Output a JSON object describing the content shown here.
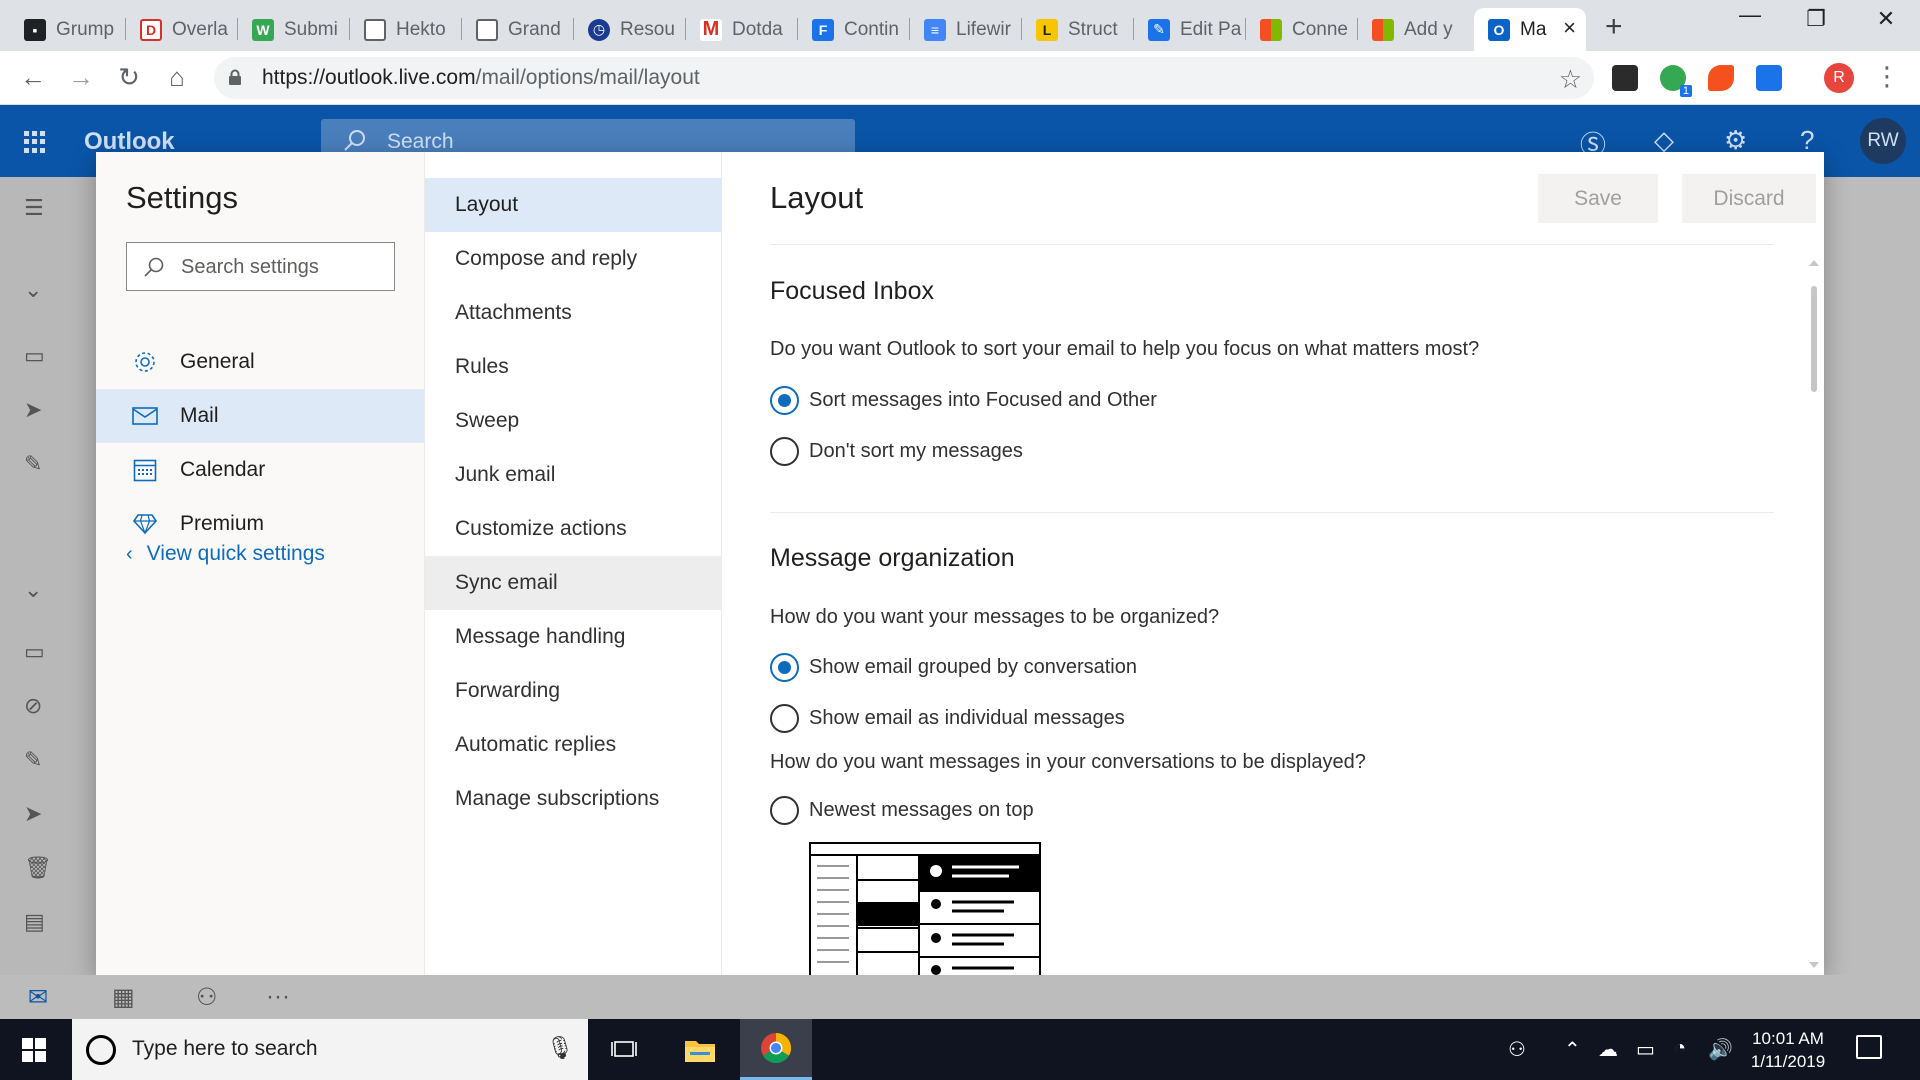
{
  "browser": {
    "tabs": [
      {
        "title": "Grump",
        "icon": "grammarly-icon",
        "color": "#202124"
      },
      {
        "title": "Overla",
        "icon": "document-icon",
        "color": "#d93025"
      },
      {
        "title": "Submi",
        "icon": "leaf-icon",
        "color": "#34a853"
      },
      {
        "title": "Hekto",
        "icon": "file-icon",
        "color": "#5f6368"
      },
      {
        "title": "Grand",
        "icon": "file-icon",
        "color": "#5f6368"
      },
      {
        "title": "Resou",
        "icon": "clock-icon",
        "color": "#1a3b8f"
      },
      {
        "title": "Dotda",
        "icon": "gmail-icon",
        "color": "#d93025"
      },
      {
        "title": "Contin",
        "icon": "flow-icon",
        "color": "#1a73e8"
      },
      {
        "title": "Lifewir",
        "icon": "docs-icon",
        "color": "#4285f4"
      },
      {
        "title": "Struct",
        "icon": "l-icon",
        "color": "#f9c400"
      },
      {
        "title": "Edit Pa",
        "icon": "edit-icon",
        "color": "#1a73e8"
      },
      {
        "title": "Conne",
        "icon": "microsoft-icon",
        "color": "#f25022"
      },
      {
        "title": "Add y",
        "icon": "microsoft-icon",
        "color": "#f25022"
      },
      {
        "title": "Ma",
        "icon": "outlook-icon",
        "color": "#0a64c8"
      }
    ],
    "url_host": "https://outlook.live.com",
    "url_path": "/mail/options/mail/layout",
    "profile_initial": "R",
    "extension_badge": "1"
  },
  "outlook": {
    "brand": "Outlook",
    "search_placeholder": "Search",
    "avatar_initials": "RW",
    "accent": "#0a55a8"
  },
  "settings": {
    "title": "Settings",
    "search_placeholder": "Search settings",
    "categories": [
      {
        "label": "General",
        "icon": "gear-icon"
      },
      {
        "label": "Mail",
        "icon": "mail-icon",
        "selected": true
      },
      {
        "label": "Calendar",
        "icon": "calendar-icon"
      },
      {
        "label": "Premium",
        "icon": "diamond-icon"
      }
    ],
    "quick_link": "View quick settings",
    "subcategories": [
      {
        "label": "Layout",
        "selected": true
      },
      {
        "label": "Compose and reply"
      },
      {
        "label": "Attachments"
      },
      {
        "label": "Rules"
      },
      {
        "label": "Sweep"
      },
      {
        "label": "Junk email"
      },
      {
        "label": "Customize actions"
      },
      {
        "label": "Sync email",
        "hover": true
      },
      {
        "label": "Message handling"
      },
      {
        "label": "Forwarding"
      },
      {
        "label": "Automatic replies"
      },
      {
        "label": "Manage subscriptions"
      }
    ]
  },
  "layout": {
    "title": "Layout",
    "save_label": "Save",
    "discard_label": "Discard",
    "focused_inbox": {
      "title": "Focused Inbox",
      "question": "Do you want Outlook to sort your email to help you focus on what matters most?",
      "options": [
        {
          "label": "Sort messages into Focused and Other",
          "checked": true
        },
        {
          "label": "Don't sort my messages",
          "checked": false
        }
      ]
    },
    "message_org": {
      "title": "Message organization",
      "question": "How do you want your messages to be organized?",
      "options": [
        {
          "label": "Show email grouped by conversation",
          "checked": true
        },
        {
          "label": "Show email as individual messages",
          "checked": false
        }
      ],
      "question2": "How do you want messages in your conversations to be displayed?",
      "options2": [
        {
          "label": "Newest messages on top",
          "checked": false
        }
      ]
    }
  },
  "taskbar": {
    "search_placeholder": "Type here to search",
    "time": "10:01 AM",
    "date": "1/11/2019"
  }
}
